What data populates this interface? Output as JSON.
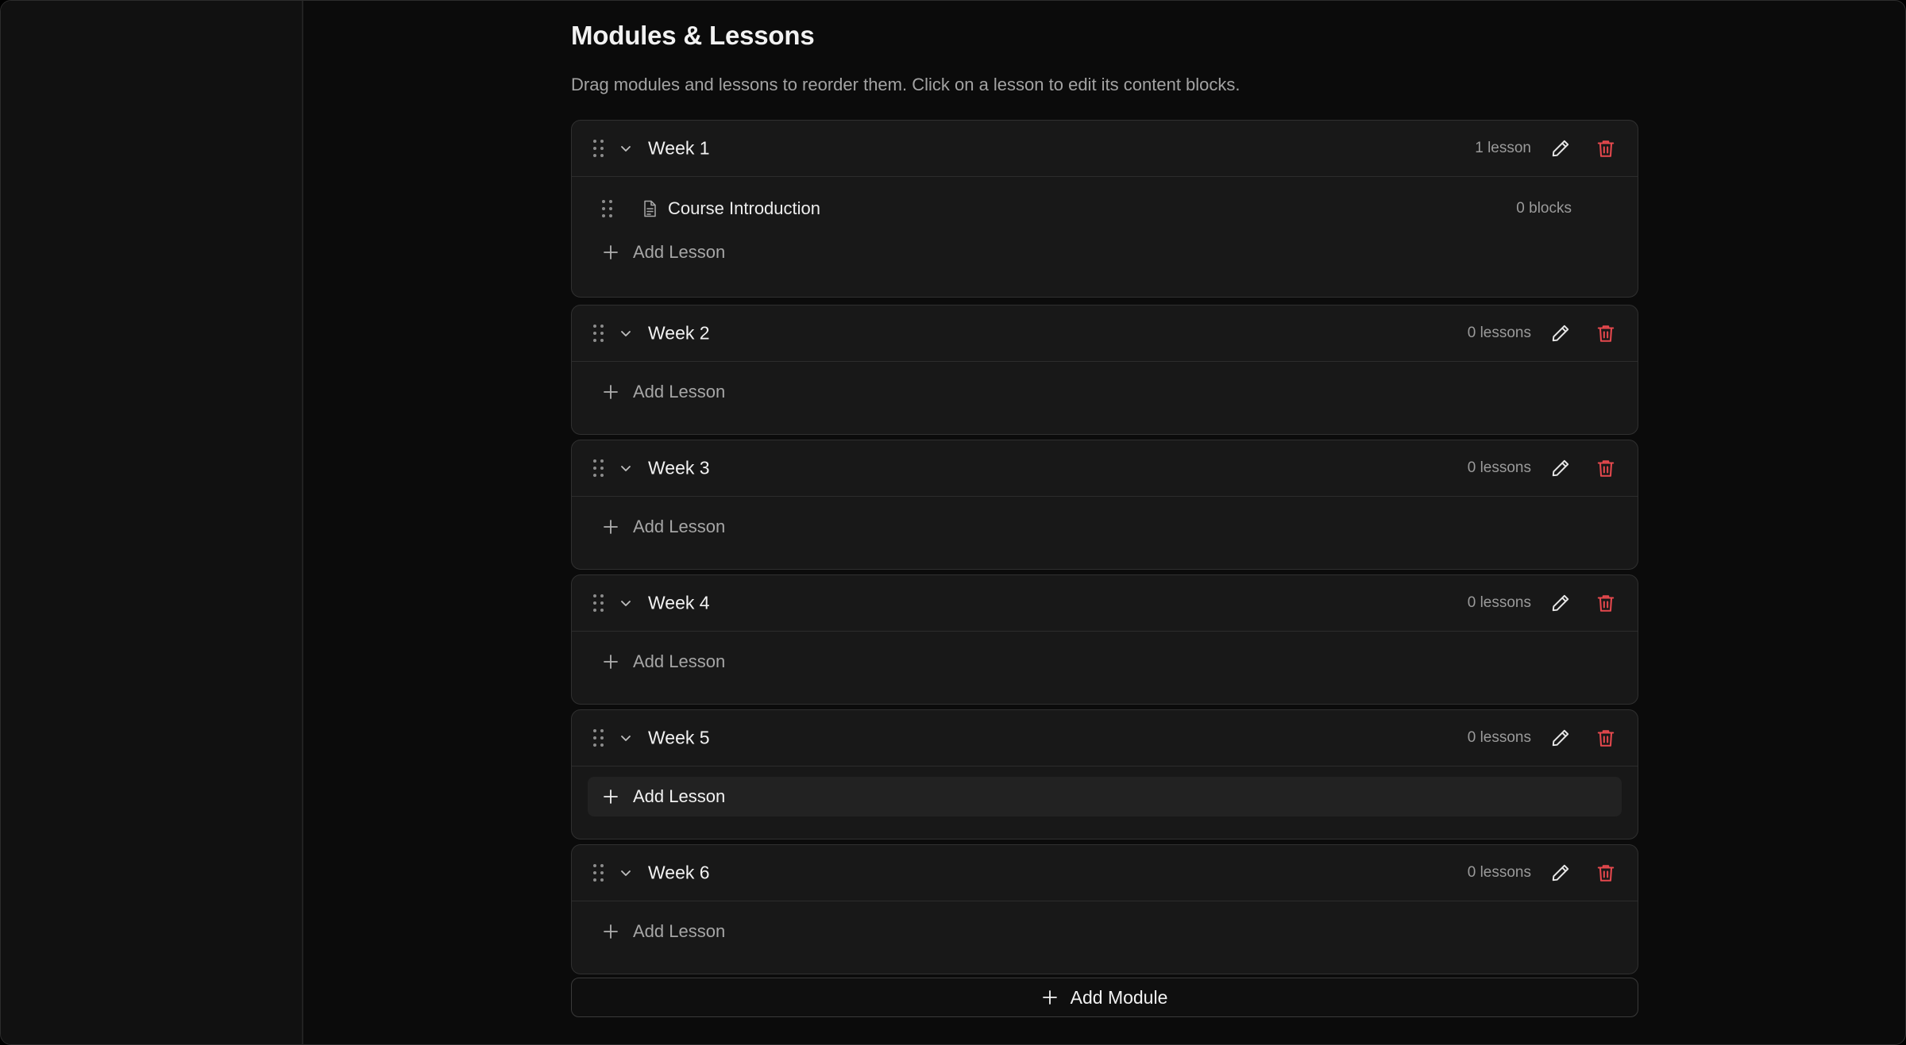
{
  "page": {
    "title": "Modules & Lessons",
    "description": "Drag modules and lessons to reorder them. Click on a lesson to edit its content blocks."
  },
  "colors": {
    "background": "#0b0b0b",
    "card": "#181818",
    "border": "#303030",
    "text": "#f2f2f2",
    "muted": "#9a9a9a",
    "delete": "#e5484d"
  },
  "icons": {
    "drag": "drag-handle-icon",
    "collapse": "chevron-down-icon",
    "edit": "pencil-icon",
    "delete": "trash-icon",
    "lesson": "document-icon",
    "add": "plus-icon"
  },
  "modules": [
    {
      "title": "Week 1",
      "count_label": "1 lesson",
      "lessons": [
        {
          "title": "Course Introduction",
          "blocks_label": "0 blocks"
        }
      ],
      "add_lesson_label": "Add Lesson"
    },
    {
      "title": "Week 2",
      "count_label": "0 lessons",
      "lessons": [],
      "add_lesson_label": "Add Lesson"
    },
    {
      "title": "Week 3",
      "count_label": "0 lessons",
      "lessons": [],
      "add_lesson_label": "Add Lesson"
    },
    {
      "title": "Week 4",
      "count_label": "0 lessons",
      "lessons": [],
      "add_lesson_label": "Add Lesson"
    },
    {
      "title": "Week 5",
      "count_label": "0 lessons",
      "lessons": [],
      "add_lesson_label": "Add Lesson"
    },
    {
      "title": "Week 6",
      "count_label": "0 lessons",
      "lessons": [],
      "add_lesson_label": "Add Lesson"
    }
  ],
  "add_module_label": "Add Module"
}
